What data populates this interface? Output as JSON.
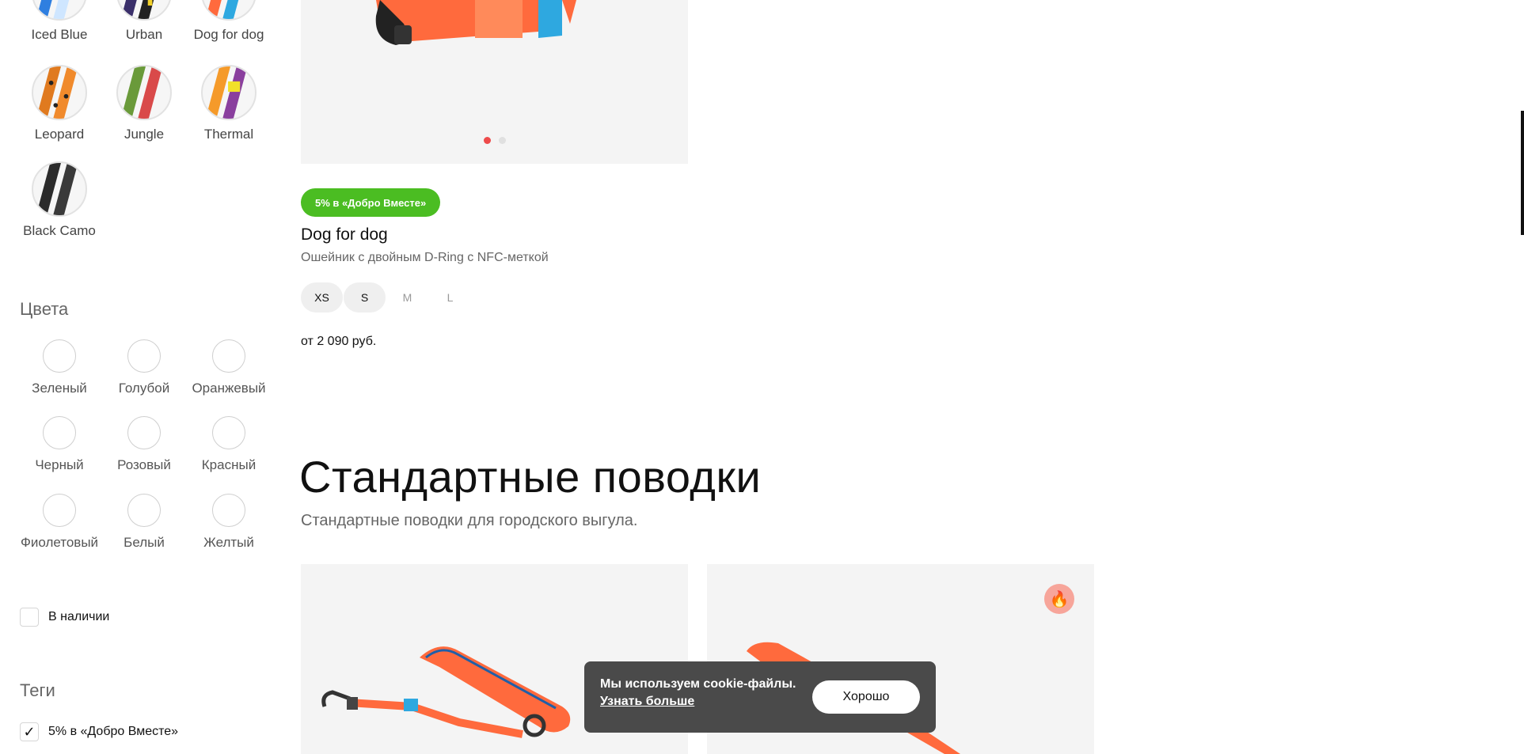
{
  "collections": [
    {
      "name": "Iced Blue",
      "icon": "iced-blue-swatch"
    },
    {
      "name": "Urban",
      "icon": "urban-swatch"
    },
    {
      "name": "Dog for dog",
      "icon": "dog-for-dog-swatch"
    },
    {
      "name": "Leopard",
      "icon": "leopard-swatch"
    },
    {
      "name": "Jungle",
      "icon": "jungle-swatch"
    },
    {
      "name": "Thermal",
      "icon": "thermal-swatch"
    },
    {
      "name": "Black Camo",
      "icon": "black-camo-swatch"
    }
  ],
  "colors": {
    "title": "Цвета",
    "options": [
      "Зеленый",
      "Голубой",
      "Оранжевый",
      "Черный",
      "Розовый",
      "Красный",
      "Фиолетовый",
      "Белый",
      "Желтый"
    ]
  },
  "stock": {
    "label": "В наличии",
    "checked": false
  },
  "tags": {
    "title": "Теги",
    "items": [
      {
        "label": "5% в «Добро Вместе»",
        "checked": true
      }
    ]
  },
  "product": {
    "badge": "5% в «Добро Вместе»",
    "name": "Dog for dog",
    "description": "Ошейник с двойным D-Ring с NFC-меткой",
    "sizes": [
      {
        "label": "XS",
        "available": true
      },
      {
        "label": "S",
        "available": true
      },
      {
        "label": "M",
        "available": false
      },
      {
        "label": "L",
        "available": false
      }
    ],
    "price": "от 2 090 руб.",
    "slide_count": 2,
    "active_slide": 1
  },
  "section": {
    "title": "Стандартные поводки",
    "subtitle": "Стандартные поводки для городского выгула."
  },
  "hot_badge": {
    "icon": "fire-icon"
  },
  "cookie": {
    "message": "Мы используем cookie-файлы.",
    "link": "Узнать больше",
    "button": "Хорошо"
  },
  "accent_colors": {
    "badge_green": "#4bbd22",
    "dot_active": "#ee4b4b",
    "leash_orange": "#ff6a3d",
    "leash_blue": "#2ea8e0"
  }
}
